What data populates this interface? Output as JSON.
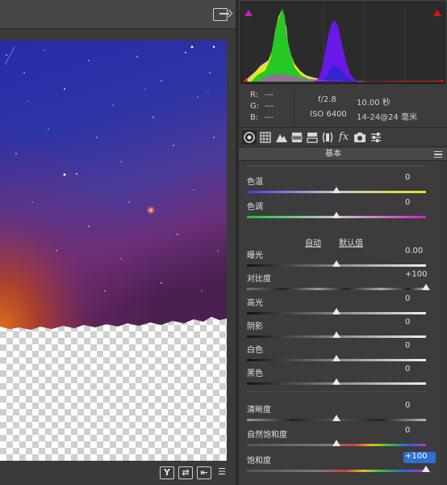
{
  "histogram": {
    "clip_shadow_color": "#c21fc2",
    "clip_highlight_color": "#e01010"
  },
  "readout": {
    "r_label": "R:",
    "g_label": "G:",
    "b_label": "B:",
    "r_value": "---",
    "g_value": "---",
    "b_value": "---",
    "aperture": "f/2.8",
    "shutter": "10.00 秒",
    "iso": "ISO 6400",
    "focal": "14-24@24 毫米"
  },
  "tabs": [
    {
      "name": "basic",
      "icon": "aperture-icon"
    },
    {
      "name": "tone-curve",
      "icon": "grid-icon"
    },
    {
      "name": "detail",
      "icon": "mountain-icon"
    },
    {
      "name": "hsl",
      "icon": "hsl-icon"
    },
    {
      "name": "split-toning",
      "icon": "split-icon"
    },
    {
      "name": "lens",
      "icon": "lens-icon"
    },
    {
      "name": "effects",
      "icon": "fx-icon"
    },
    {
      "name": "camera-calibration",
      "icon": "camera-icon"
    },
    {
      "name": "presets",
      "icon": "sliders-icon"
    }
  ],
  "section": {
    "title": "基本"
  },
  "auto_label": "自动",
  "default_label": "默认值",
  "sliders": {
    "temp": {
      "label": "色温",
      "value": "0",
      "level": 0.5
    },
    "tint": {
      "label": "色调",
      "value": "0",
      "level": 0.5
    },
    "exposure": {
      "label": "曝光",
      "value": "0.00",
      "level": 0.5
    },
    "contrast": {
      "label": "对比度",
      "value": "+100",
      "level": 1.0
    },
    "highlights": {
      "label": "高光",
      "value": "0",
      "level": 0.5
    },
    "shadows": {
      "label": "阴影",
      "value": "0",
      "level": 0.5
    },
    "whites": {
      "label": "白色",
      "value": "0",
      "level": 0.5
    },
    "blacks": {
      "label": "黑色",
      "value": "0",
      "level": 0.5
    },
    "clarity": {
      "label": "清晰度",
      "value": "0",
      "level": 0.5
    },
    "vibrance": {
      "label": "自然饱和度",
      "value": "0",
      "level": 0.5
    },
    "saturation": {
      "label": "饱和度",
      "value": "+100",
      "level": 1.0
    }
  },
  "bottom_buttons": {
    "y_label": "Y"
  }
}
